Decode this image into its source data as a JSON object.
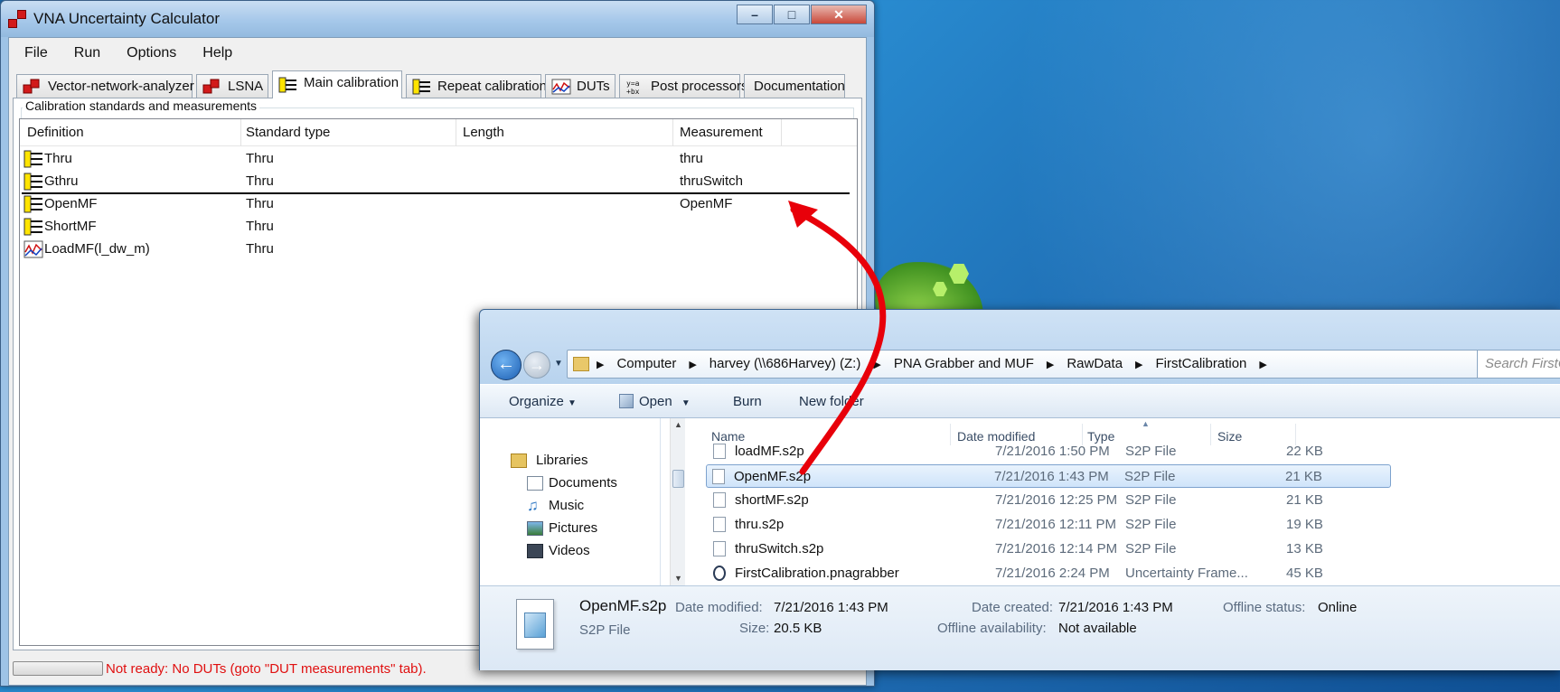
{
  "vna_window": {
    "title": "VNA Uncertainty Calculator",
    "controls": {
      "minimize": "–",
      "maximize": "□",
      "close": "✕"
    },
    "menu": [
      "File",
      "Run",
      "Options",
      "Help"
    ],
    "tabs": [
      {
        "label": "Vector-network-analyzer",
        "icon": "vna-icon"
      },
      {
        "label": "LSNA",
        "icon": "lsna-icon"
      },
      {
        "label": "Main calibration",
        "icon": "calibration-icon",
        "active": true
      },
      {
        "label": "Repeat calibration",
        "icon": "calibration-icon"
      },
      {
        "label": "DUTs",
        "icon": "dut-plot-icon"
      },
      {
        "label": "Post processors",
        "icon": "post-processor-icon"
      },
      {
        "label": "Documentation",
        "icon": ""
      }
    ],
    "group_title": "Calibration standards and measurements",
    "columns": [
      "Definition",
      "Standard type",
      "Length",
      "Measurement"
    ],
    "rows": [
      {
        "definition": "Thru",
        "standard_type": "Thru",
        "length": "",
        "measurement": "thru",
        "icon": "calibration-icon"
      },
      {
        "definition": "Gthru",
        "standard_type": "Thru",
        "length": "",
        "measurement": "thruSwitch",
        "icon": "calibration-icon"
      },
      {
        "definition": "OpenMF",
        "standard_type": "Thru",
        "length": "",
        "measurement": "OpenMF",
        "icon": "calibration-icon"
      },
      {
        "definition": "ShortMF",
        "standard_type": "Thru",
        "length": "",
        "measurement": "",
        "icon": "calibration-icon"
      },
      {
        "definition": "LoadMF(l_dw_m)",
        "standard_type": "Thru",
        "length": "",
        "measurement": "",
        "icon": "plot-icon"
      }
    ],
    "status_text": "Not ready: No DUTs (goto \"DUT measurements\" tab).",
    "status_progress": 0,
    "status_color": "#e01010"
  },
  "explorer_window": {
    "breadcrumbs": [
      "Computer",
      "harvey (\\\\686Harvey) (Z:)",
      "PNA Grabber and MUF",
      "RawData",
      "FirstCalibration"
    ],
    "search_placeholder": "Search FirstCalibration",
    "toolbar": [
      "Organize",
      "Open",
      "Burn",
      "New folder"
    ],
    "nav": {
      "libraries": "Libraries",
      "items": [
        {
          "label": "Documents",
          "icon": "documents-icon"
        },
        {
          "label": "Music",
          "icon": "music-icon"
        },
        {
          "label": "Pictures",
          "icon": "pictures-icon"
        },
        {
          "label": "Videos",
          "icon": "videos-icon"
        }
      ]
    },
    "columns": [
      "Name",
      "Date modified",
      "Type",
      "Size"
    ],
    "files": [
      {
        "name": "loadMF.s2p",
        "date": "7/21/2016 1:50 PM",
        "type": "S2P File",
        "size": "22 KB"
      },
      {
        "name": "OpenMF.s2p",
        "date": "7/21/2016 1:43 PM",
        "type": "S2P File",
        "size": "21 KB",
        "selected": true
      },
      {
        "name": "shortMF.s2p",
        "date": "7/21/2016 12:25 PM",
        "type": "S2P File",
        "size": "21 KB"
      },
      {
        "name": "thru.s2p",
        "date": "7/21/2016 12:11 PM",
        "type": "S2P File",
        "size": "19 KB"
      },
      {
        "name": "thruSwitch.s2p",
        "date": "7/21/2016 12:14 PM",
        "type": "S2P File",
        "size": "13 KB"
      },
      {
        "name": "FirstCalibration.pnagrabber",
        "date": "7/21/2016 2:24 PM",
        "type": "Uncertainty Frame...",
        "size": "45 KB"
      }
    ],
    "details": {
      "name": "OpenMF.s2p",
      "kind": "S2P File",
      "date_modified_label": "Date modified:",
      "date_modified": "7/21/2016 1:43 PM",
      "size_label": "Size:",
      "size": "20.5 KB",
      "date_created_label": "Date created:",
      "date_created": "7/21/2016 1:43 PM",
      "offline_availability_label": "Offline availability:",
      "offline_availability": "Not available",
      "offline_status_label": "Offline status:",
      "offline_status": "Online"
    }
  },
  "annotation_arrow_color": "#e8000a"
}
